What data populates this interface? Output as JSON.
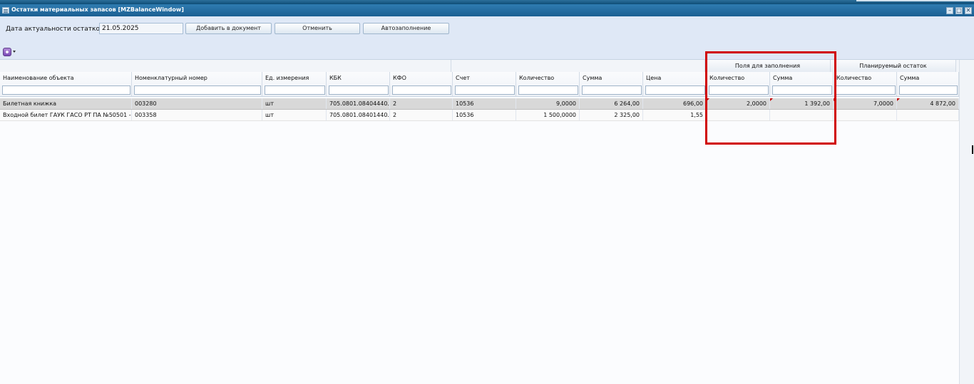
{
  "window": {
    "title": "Остатки материальных запасов [MZBalanceWindow]",
    "minimize_glyph": "–",
    "maximize_glyph": "□",
    "close_glyph": "✕"
  },
  "toolbar": {
    "date_label": "Дата актуальности остатков:",
    "date_value": "21.05.2025",
    "add_button": "Добавить в документ",
    "cancel_button": "Отменить",
    "autofill_button": "Автозаполнение",
    "settings_icon": "gear-icon"
  },
  "grid": {
    "groups": {
      "fill": "Поля для заполнения",
      "planned": "Планируемый остаток"
    },
    "columns": {
      "name": "Наименование объекта",
      "nomenclature": "Номенклатурный номер",
      "unit": "Ед. измерения",
      "kbk": "КБК",
      "kfo": "КФО",
      "account": "Счет",
      "qty": "Количество",
      "sum": "Сумма",
      "price": "Цена",
      "fill_qty": "Количество",
      "fill_sum": "Сумма",
      "plan_qty": "Количество",
      "plan_sum": "Сумма"
    },
    "rows": [
      {
        "name": "Билетная книжка",
        "nomenclature": "003280",
        "unit": "шт",
        "kbk": "705.0801.08404440...",
        "kfo": "2",
        "account": "10536",
        "qty": "9,0000",
        "sum": "6 264,00",
        "price": "696,00",
        "fill_qty": "2,0000",
        "fill_sum": "1 392,00",
        "plan_qty": "7,0000",
        "plan_sum": "4 872,00"
      },
      {
        "name": "Входной билет ГАУК ГАСО РТ ПА №50501 - ...",
        "nomenclature": "003358",
        "unit": "шт",
        "kbk": "705.0801.08401440...",
        "kfo": "2",
        "account": "10536",
        "qty": "1 500,0000",
        "sum": "2 325,00",
        "price": "1,55",
        "fill_qty": "",
        "fill_sum": "",
        "plan_qty": "",
        "plan_sum": ""
      }
    ]
  },
  "colors": {
    "title_bar": "#1b5f92",
    "toolbar_bg": "#dfe8f6",
    "selected_row": "#d8d8d8",
    "highlight_box": "#d00000"
  }
}
